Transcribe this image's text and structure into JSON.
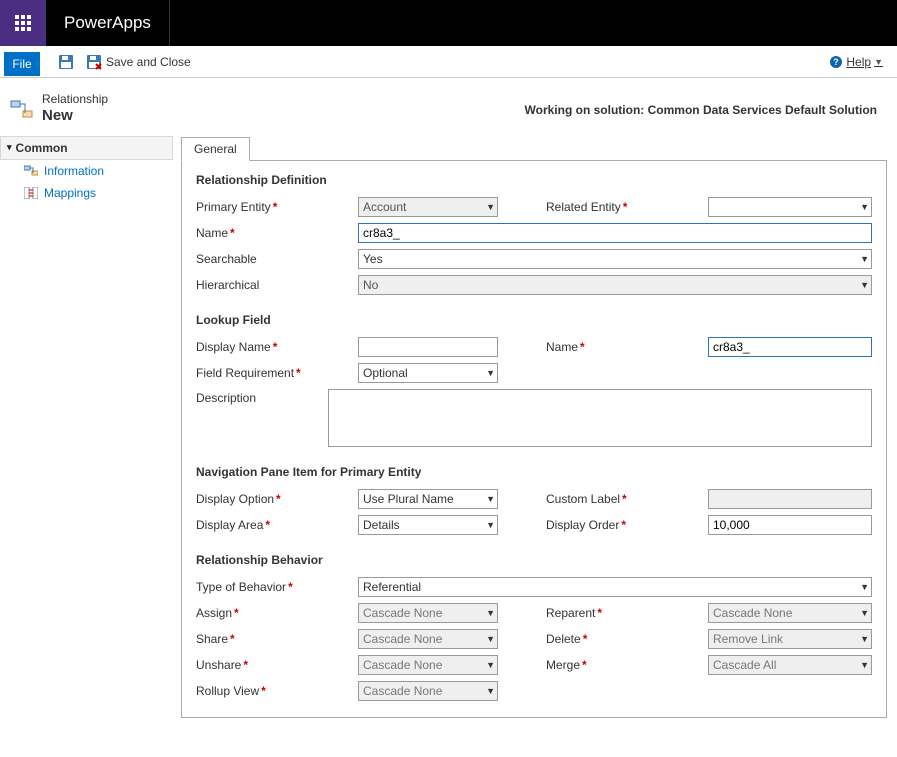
{
  "topbar": {
    "brand": "PowerApps"
  },
  "toolbar": {
    "file_label": "File",
    "save_and_close_label": "Save and Close",
    "help_label": "Help"
  },
  "header": {
    "breadcrumb": "Relationship",
    "title": "New",
    "working_on": "Working on solution: Common Data Services Default Solution"
  },
  "sidebar": {
    "section_label": "Common",
    "items": [
      {
        "label": "Information"
      },
      {
        "label": "Mappings"
      }
    ]
  },
  "tabs": [
    "General"
  ],
  "sections": {
    "rel_def": {
      "title": "Relationship Definition",
      "primary_entity_label": "Primary Entity",
      "primary_entity_value": "Account",
      "related_entity_label": "Related Entity",
      "related_entity_value": "",
      "name_label": "Name",
      "name_value": "cr8a3_",
      "searchable_label": "Searchable",
      "searchable_value": "Yes",
      "hierarchical_label": "Hierarchical",
      "hierarchical_value": "No"
    },
    "lookup": {
      "title": "Lookup Field",
      "display_name_label": "Display Name",
      "display_name_value": "",
      "name_label": "Name",
      "name_value": "cr8a3_",
      "field_req_label": "Field Requirement",
      "field_req_value": "Optional",
      "description_label": "Description",
      "description_value": ""
    },
    "navpane": {
      "title": "Navigation Pane Item for Primary Entity",
      "display_option_label": "Display Option",
      "display_option_value": "Use Plural Name",
      "custom_label_label": "Custom Label",
      "custom_label_value": "",
      "display_area_label": "Display Area",
      "display_area_value": "Details",
      "display_order_label": "Display Order",
      "display_order_value": "10,000"
    },
    "behavior": {
      "title": "Relationship Behavior",
      "type_label": "Type of Behavior",
      "type_value": "Referential",
      "assign_label": "Assign",
      "assign_value": "Cascade None",
      "reparent_label": "Reparent",
      "reparent_value": "Cascade None",
      "share_label": "Share",
      "share_value": "Cascade None",
      "delete_label": "Delete",
      "delete_value": "Remove Link",
      "unshare_label": "Unshare",
      "unshare_value": "Cascade None",
      "merge_label": "Merge",
      "merge_value": "Cascade All",
      "rollup_label": "Rollup View",
      "rollup_value": "Cascade None"
    }
  }
}
